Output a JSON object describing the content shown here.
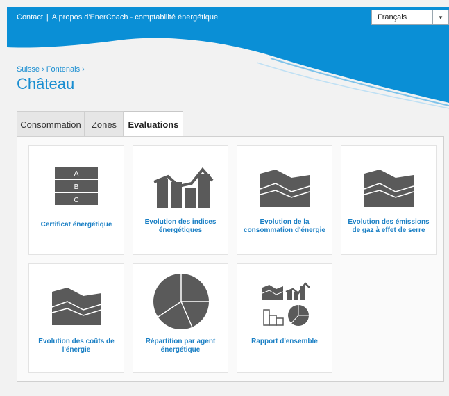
{
  "topbar": {
    "contact": "Contact",
    "about": "A propos d'EnerCoach - comptabilité énergétique",
    "language": "Français"
  },
  "breadcrumb": "Suisse › Fontenais ›",
  "page_title": "Château",
  "tabs": [
    {
      "label": "Consommation",
      "active": false
    },
    {
      "label": "Zones",
      "active": false
    },
    {
      "label": "Evaluations",
      "active": true
    }
  ],
  "cards": {
    "certificat": {
      "label": "Certificat énergétique",
      "icon": "energy-certificate-icon",
      "grades": [
        "A",
        "B",
        "C"
      ]
    },
    "indices": {
      "label": "Evolution des indices énergétiques",
      "icon": "bar-trend-chart-icon"
    },
    "consommation": {
      "label": "Evolution de la consommation d'énergie",
      "icon": "area-chart-icon"
    },
    "emissions": {
      "label": "Evolution des émissions de gaz à effet de serre",
      "icon": "area-chart-icon"
    },
    "couts": {
      "label": "Evolution des coûts de l'énergie",
      "icon": "area-chart-icon"
    },
    "repartition": {
      "label": "Répartition par agent énergétique",
      "icon": "pie-chart-icon"
    },
    "rapport": {
      "label": "Rapport d'ensemble",
      "icon": "report-overview-icon"
    }
  },
  "colors": {
    "brand_blue": "#0a8fd6",
    "link_blue": "#1a7fc4",
    "icon_gray": "#5a5a5a"
  }
}
